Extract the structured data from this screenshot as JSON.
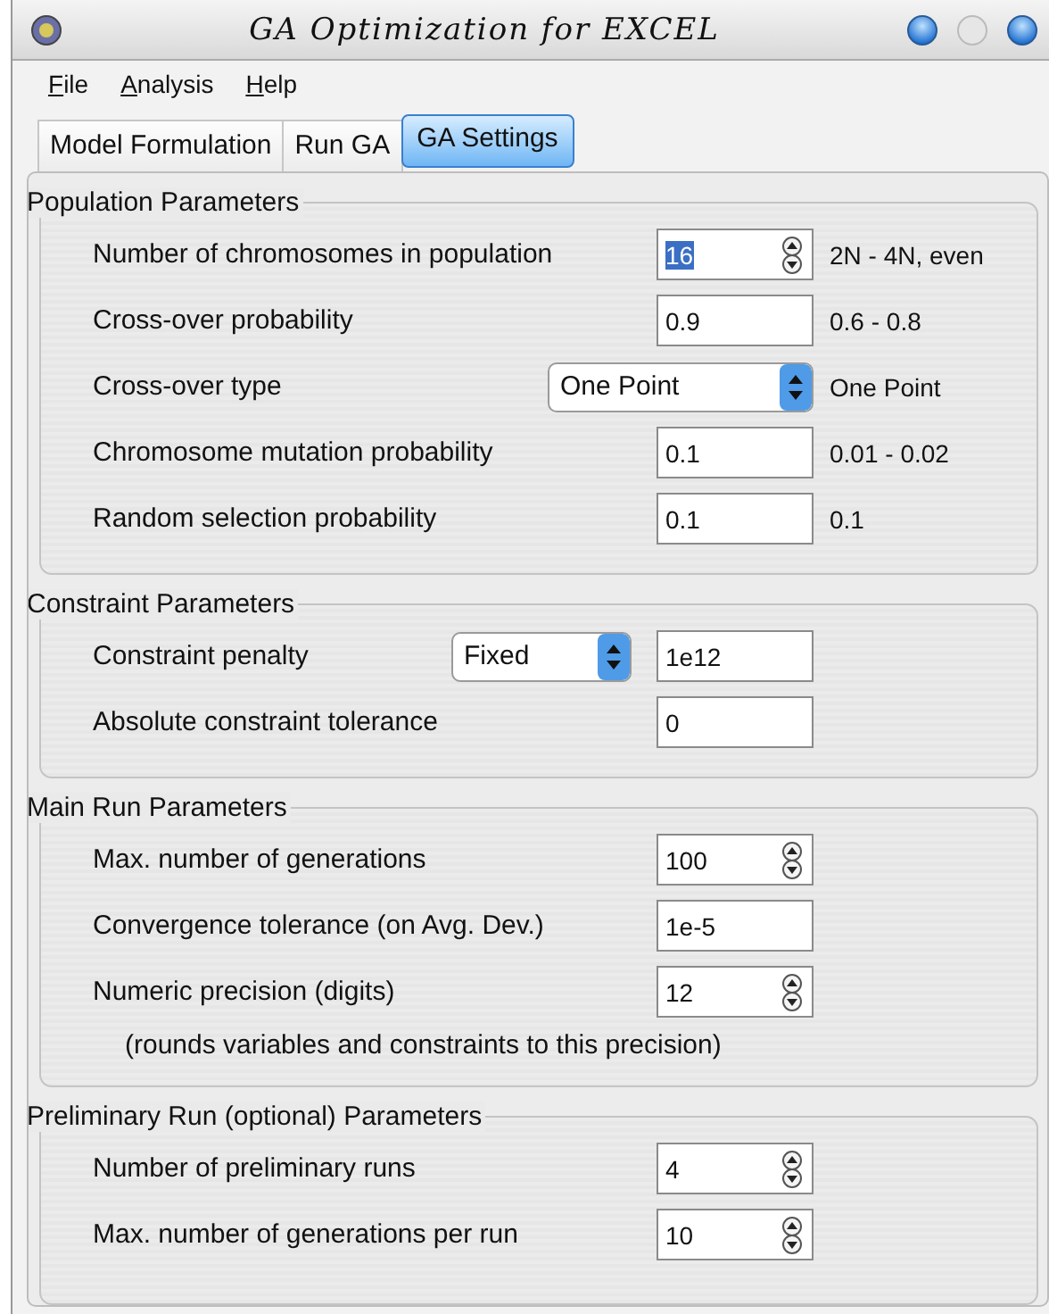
{
  "window": {
    "title": "GA Optimization for EXCEL"
  },
  "menu": [
    "File",
    "Analysis",
    "Help"
  ],
  "tabs": [
    {
      "label": "Model Formulation",
      "selected": false
    },
    {
      "label": "Run GA",
      "selected": false
    },
    {
      "label": "GA Settings",
      "selected": true
    }
  ],
  "groups": [
    {
      "title": "Population Parameters",
      "rows": [
        {
          "kind": "spin",
          "label": "Number of chromosomes in population",
          "value": "16",
          "value_selected": true,
          "hint": "2N - 4N, even"
        },
        {
          "kind": "text",
          "label": "Cross-over probability",
          "value": "0.9",
          "value_selected": false,
          "hint": "0.6 - 0.8"
        },
        {
          "kind": "select",
          "label": "Cross-over type",
          "choice": "One Point",
          "hint": "One Point"
        },
        {
          "kind": "text",
          "label": "Chromosome mutation probability",
          "value": "0.1",
          "value_selected": false,
          "hint": "0.01 - 0.02"
        },
        {
          "kind": "text",
          "label": "Random selection probability",
          "value": "0.1",
          "value_selected": false,
          "hint": "0.1"
        }
      ]
    },
    {
      "title": "Constraint Parameters",
      "rows": [
        {
          "kind": "select-text",
          "label": "Constraint penalty",
          "choice": "Fixed",
          "value": "1e12",
          "value_selected": false
        },
        {
          "kind": "text",
          "label": "Absolute constraint tolerance",
          "value": "0",
          "value_selected": false
        }
      ]
    },
    {
      "title": "Main Run Parameters",
      "rows": [
        {
          "kind": "spin",
          "label": "Max. number of generations",
          "value": "100",
          "value_selected": false
        },
        {
          "kind": "text",
          "label": "Convergence tolerance (on Avg. Dev.)",
          "value": "1e-5",
          "value_selected": false
        },
        {
          "kind": "spin",
          "label": "Numeric precision (digits)",
          "value": "12",
          "value_selected": false
        },
        {
          "kind": "note",
          "label": "(rounds variables and constraints to this precision)"
        }
      ]
    },
    {
      "title": "Preliminary Run (optional) Parameters",
      "rows": [
        {
          "kind": "spin",
          "label": "Number of preliminary runs",
          "value": "4",
          "value_selected": false
        },
        {
          "kind": "spin",
          "label": "Max. number of generations per run",
          "value": "10",
          "value_selected": false
        }
      ]
    }
  ]
}
